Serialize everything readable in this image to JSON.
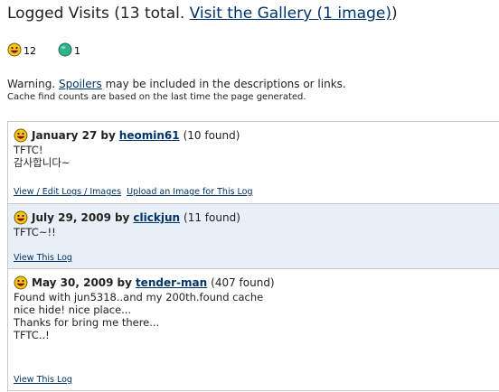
{
  "header": {
    "title_prefix": "Logged Visits (13 total. ",
    "gallery_link": "Visit the Gallery (1 image)",
    "title_suffix": ")"
  },
  "counts": [
    {
      "icon": "smiley-found-icon",
      "value": "12"
    },
    {
      "icon": "green-circle-icon",
      "value": "1"
    }
  ],
  "warning": {
    "prefix": "Warning. ",
    "link": "Spoilers",
    "suffix": " may be included in the descriptions or links."
  },
  "note": "Cache find counts are based on the last time the page generated.",
  "logs": [
    {
      "date": "January 27",
      "by": "by",
      "user": "heomin61",
      "found": "(10 found)",
      "text": "TFTC!\n감사합니다~",
      "links": [
        "View / Edit Logs / Images",
        "Upload an Image for This Log"
      ]
    },
    {
      "date": "July 29, 2009",
      "by": "by",
      "user": "clickjun",
      "found": "(11 found)",
      "text": "TFTC~!!",
      "links": [
        "View This Log"
      ]
    },
    {
      "date": "May 30, 2009",
      "by": "by",
      "user": "tender-man",
      "found": "(407 found)",
      "text": "Found with jun5318..and my 200th.found cache\nnice hide! nice place...\nThanks for bring me there...\nTFTC..!",
      "links": [
        "View This Log"
      ]
    }
  ],
  "colors": {
    "link": "#003366",
    "alt_row": "#e9eff6",
    "smiley": "#f5c518",
    "green": "#2fb38e"
  }
}
